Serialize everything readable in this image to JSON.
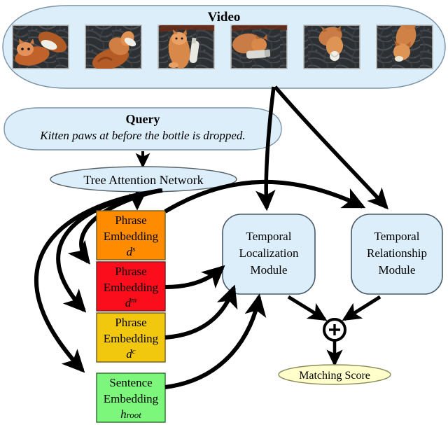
{
  "video_panel": {
    "title": "Video",
    "fill": "#ddeefb",
    "stroke": "#7b93a8",
    "frames": [
      {
        "name": "frame-1",
        "caption": "kitten reaching toward bottle on dark carpet"
      },
      {
        "name": "frame-2",
        "caption": "kitten pawing at the bottle"
      },
      {
        "name": "frame-3",
        "caption": "kitten standing over upright bottle"
      },
      {
        "name": "frame-4",
        "caption": "kitten lying beside fallen bottle"
      },
      {
        "name": "frame-5",
        "caption": "kitten looking down at dark carpet"
      },
      {
        "name": "frame-6",
        "caption": "kitten walking away across carpet"
      }
    ]
  },
  "query_panel": {
    "title": "Query",
    "text": "Kitten paws at before the bottle is dropped.",
    "fill": "#ddeefb",
    "stroke": "#7b93a8"
  },
  "tree_attention": {
    "label": "Tree Attention Network",
    "fill": "#ddeefb",
    "stroke": "#7b93a8"
  },
  "embeddings": [
    {
      "name": "phrase-embedding-s",
      "line1": "Phrase",
      "line2": "Embedding",
      "symbol": "d",
      "superscript": "s",
      "fill": "#ff8c00",
      "stroke": "#6b5a20"
    },
    {
      "name": "phrase-embedding-m",
      "line1": "Phrase",
      "line2": "Embedding",
      "symbol": "d",
      "superscript": "m",
      "fill": "#fc0d1b",
      "stroke": "#6b2020"
    },
    {
      "name": "phrase-embedding-c",
      "line1": "Phrase",
      "line2": "Embedding",
      "symbol": "d",
      "superscript": "c",
      "fill": "#f2c80f",
      "stroke": "#6b5a20"
    },
    {
      "name": "sentence-embedding-root",
      "line1": "Sentence",
      "line2": "Embedding",
      "symbol": "h",
      "superscript": "root",
      "fill": "#7cf77c",
      "stroke": "#2a6b2a"
    }
  ],
  "modules": [
    {
      "name": "temporal-localization-module",
      "lines": [
        "Temporal",
        "Localization",
        "Module"
      ],
      "fill": "#ddeefb",
      "stroke": "#4a5a68"
    },
    {
      "name": "temporal-relationship-module",
      "lines": [
        "Temporal",
        "Relationship",
        "Module"
      ],
      "fill": "#ddeefb",
      "stroke": "#4a5a68"
    }
  ],
  "sum_node": {
    "name": "sum-operator",
    "symbol": "+",
    "fill": "#ffffff",
    "stroke": "#000000"
  },
  "output": {
    "label": "Matching Score",
    "fill": "#ffffcc",
    "stroke": "#8a8a5a"
  },
  "arrow_color": "#000000"
}
